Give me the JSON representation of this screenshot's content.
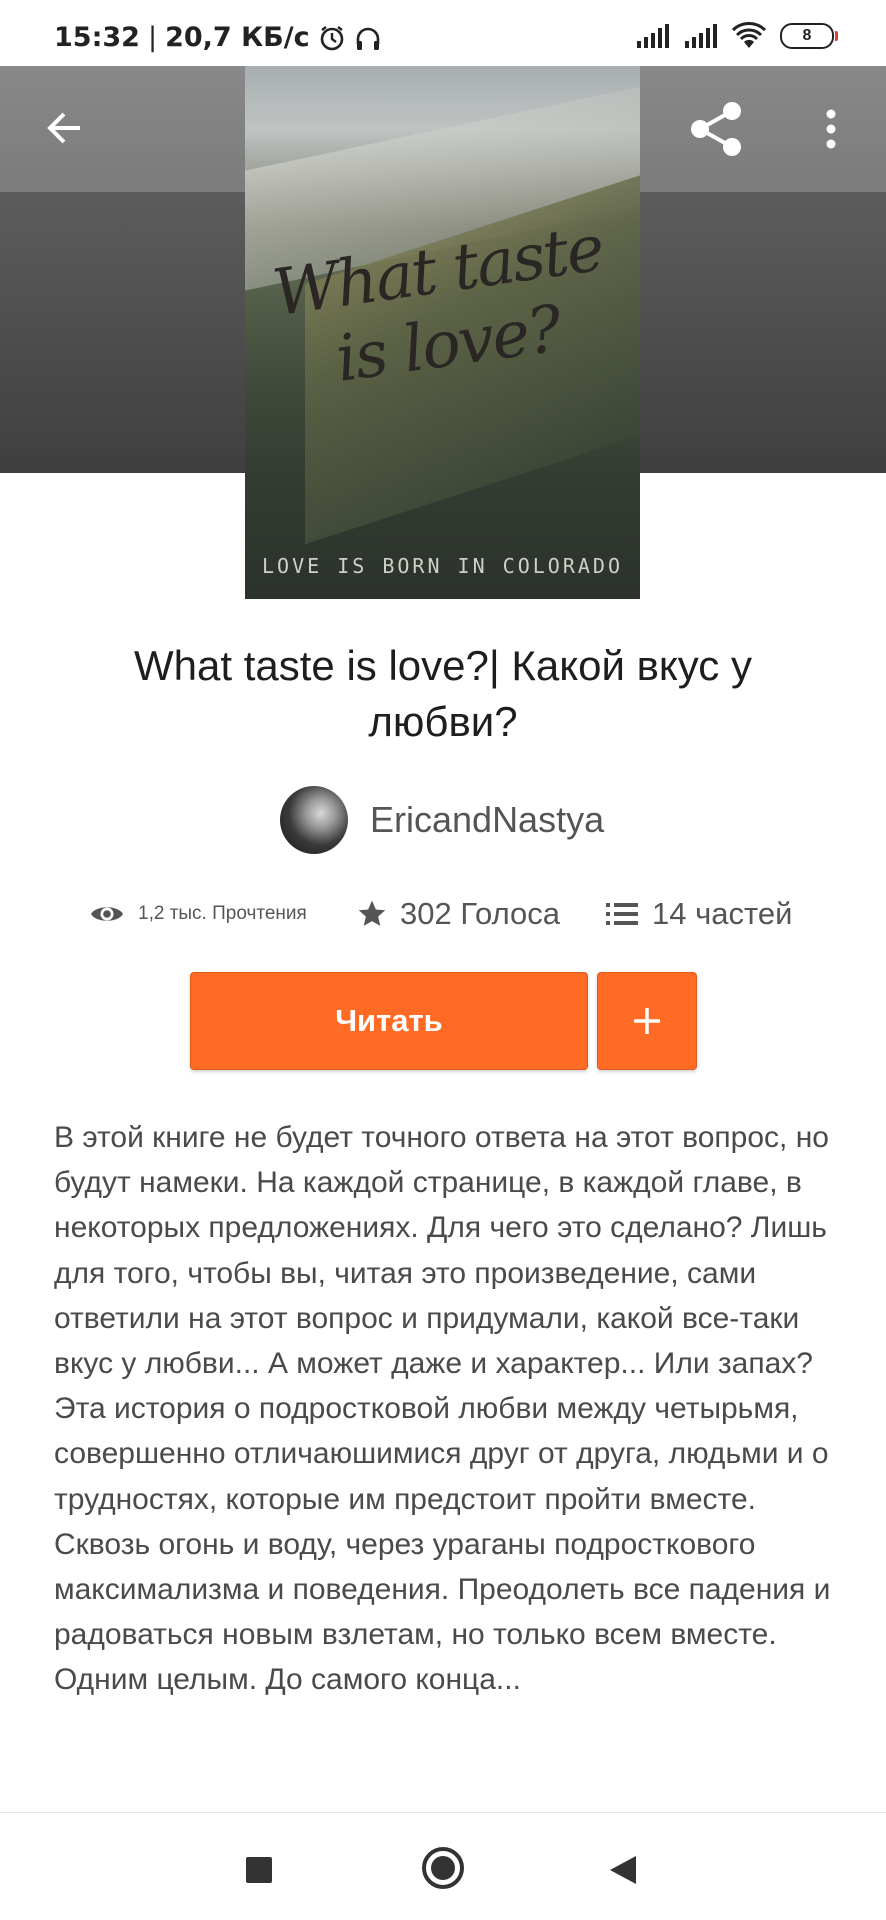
{
  "status_bar": {
    "time": "15:32",
    "separator": "|",
    "speed": "20,7 КБ/с",
    "battery": "8"
  },
  "icons": {
    "back": "arrow-back-icon",
    "share": "share-icon",
    "more": "more-vert-icon",
    "views": "eye-icon",
    "votes": "star-icon",
    "parts": "list-icon",
    "add": "plus-icon",
    "nav_recent": "square-icon",
    "nav_home": "circle-icon",
    "nav_back": "triangle-back-icon"
  },
  "book": {
    "cover_script": "What taste is love?",
    "cover_tagline": "LOVE IS BORN IN COLORADO",
    "title": "What taste is love?| Какой вкус у любви?",
    "author": "EricandNastya"
  },
  "stats": {
    "reads": "1,2 тыс. Прочтения",
    "votes": "302 Голоса",
    "parts": "14 частей"
  },
  "actions": {
    "read_label": "Читать",
    "add_label": "+"
  },
  "description": {
    "paragraph1": "В этой книге не будет точного ответа на этот вопрос, но будут намеки. На каждой странице, в каждой главе, в некоторых предложениях. Для чего это сделано? Лишь для того, чтобы вы, читая это произведение, сами ответили на этот вопрос и придумали, какой все-таки вкус у любви... А может даже и характер... Или запах?",
    "paragraph2": "Эта история о подростковой любви между четырьмя, совершенно отличаюшимися друг от друга, людьми и о трудностях, которые им предстоит пройти вместе. Сквозь огонь и воду, через ураганы подросткового максимализма и поведения. Преодолеть все падения и радоваться новым взлетам, но только всем вместе. Одним целым. До самого конца..."
  },
  "colors": {
    "accent": "#ff6a24",
    "text": "#1e1e1e",
    "muted": "#555555"
  }
}
